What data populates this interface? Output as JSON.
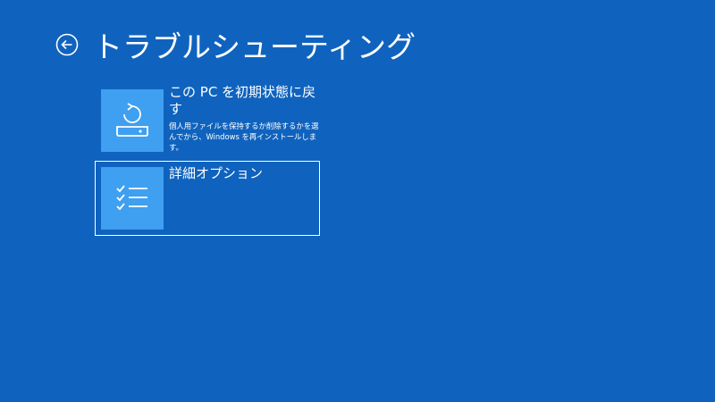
{
  "header": {
    "title": "トラブルシューティング"
  },
  "options": [
    {
      "title": "この PC を初期状態に戻す",
      "description": "個人用ファイルを保持するか削除するかを選んでから、Windows を再インストールします。"
    },
    {
      "title": "詳細オプション",
      "description": ""
    }
  ]
}
